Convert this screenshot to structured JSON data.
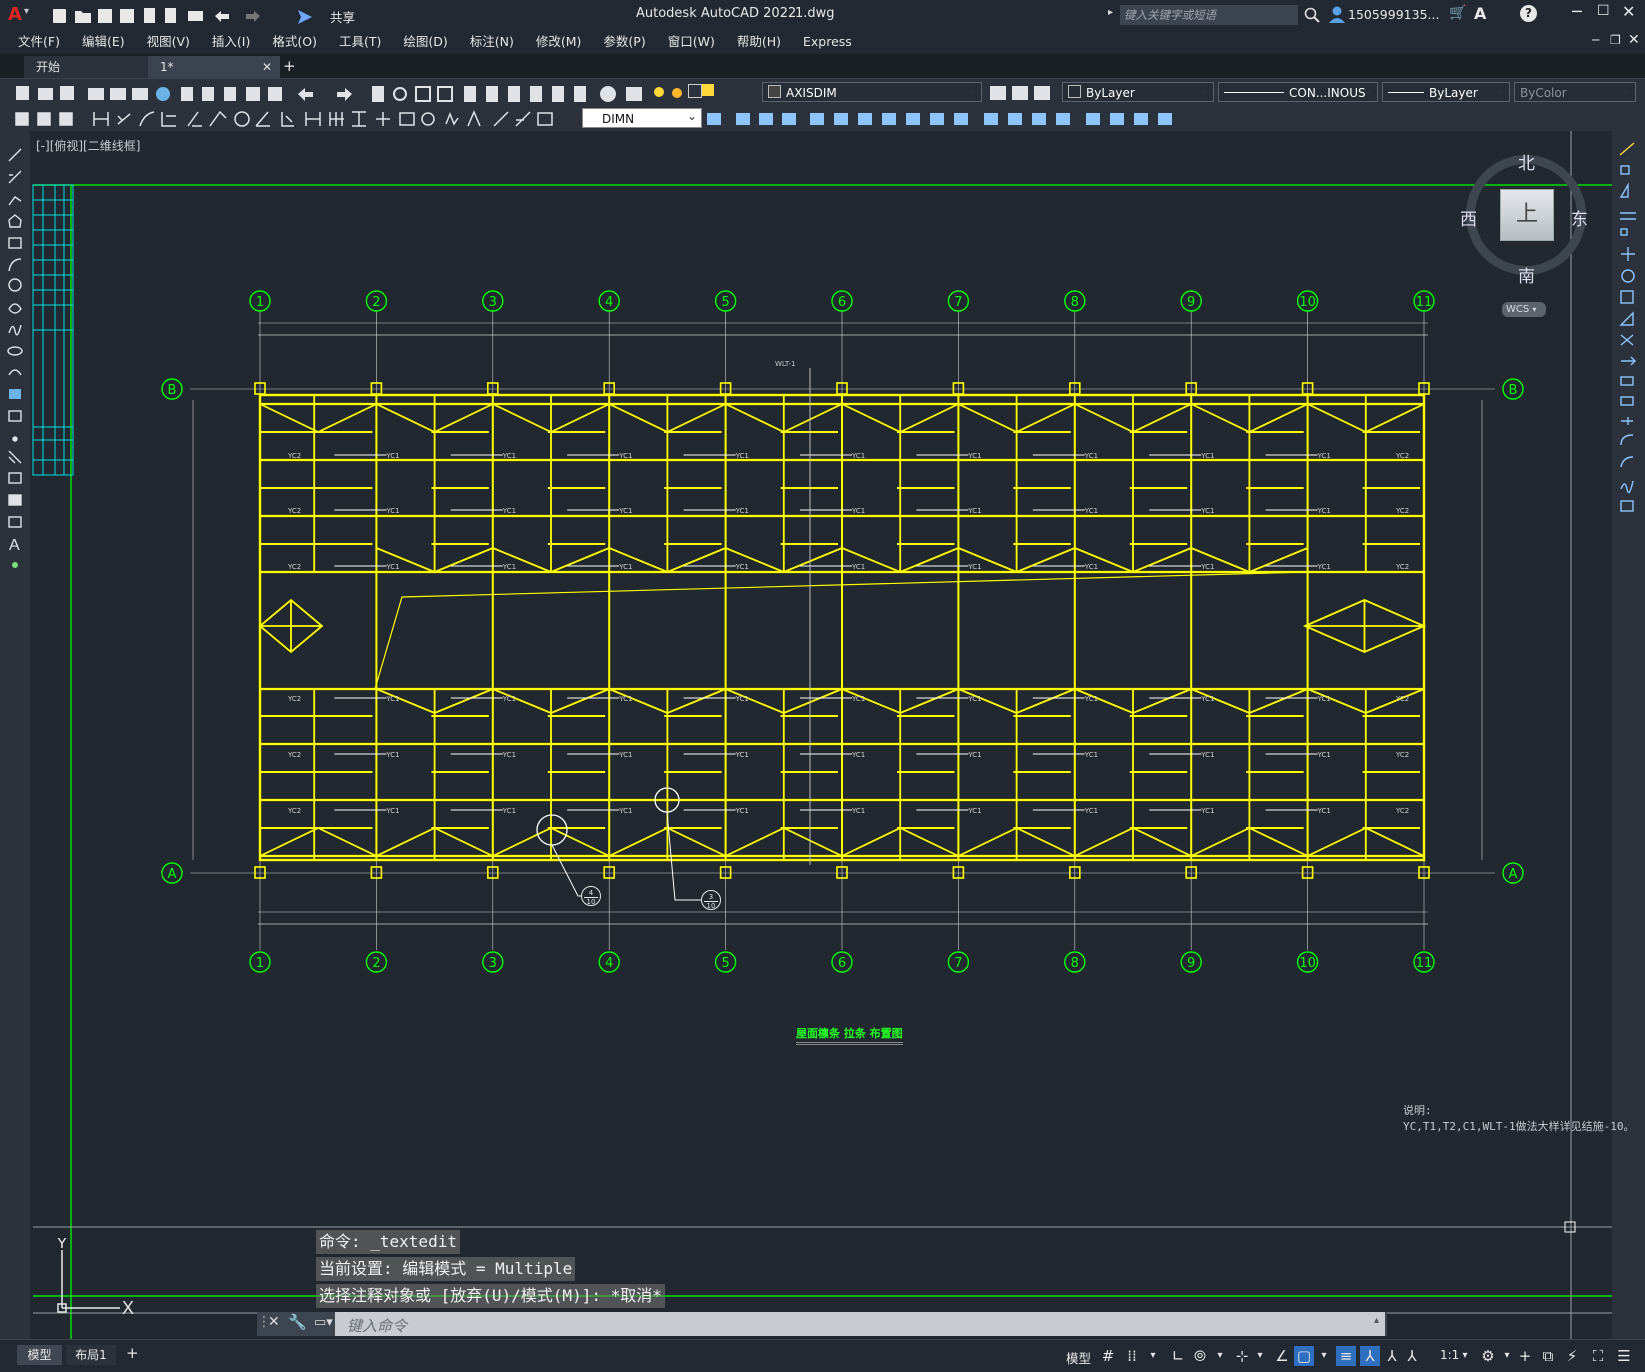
{
  "app": {
    "title": "Autodesk AutoCAD 2022",
    "file": "1.dwg",
    "share_label": "共享",
    "search_placeholder": "键入关键字或短语",
    "user": "1505999135..."
  },
  "menu": [
    "文件(F)",
    "编辑(E)",
    "视图(V)",
    "插入(I)",
    "格式(O)",
    "工具(T)",
    "绘图(D)",
    "标注(N)",
    "修改(M)",
    "参数(P)",
    "窗口(W)",
    "帮助(H)",
    "Express"
  ],
  "tabs": [
    {
      "label": "开始"
    },
    {
      "label": "1*"
    }
  ],
  "toolbar": {
    "dimstyle": "AXISDIM",
    "layer_color": "ByLayer",
    "linetype": "CON...INOUS",
    "lineweight": "ByLayer",
    "plotstyle": "ByColor",
    "layer": "DIMN"
  },
  "viewport": {
    "label": "[-][俯视][二维线框]",
    "viewcube": {
      "north": "北",
      "south": "南",
      "east": "东",
      "west": "西",
      "top": "上",
      "wcs": "WCS"
    }
  },
  "drawing": {
    "axes_top": [
      "1",
      "2",
      "3",
      "4",
      "5",
      "6",
      "7",
      "8",
      "9",
      "10",
      "11"
    ],
    "axes_side": [
      "B",
      "A"
    ],
    "title": "屋面檩条 拉条 布置图",
    "note_title": "说明:",
    "note_body": "YC,T1,T2,C1,WLT-1做法大样详见结施-10。",
    "callouts": [
      {
        "top": "4",
        "bottom": "10"
      },
      {
        "top": "3",
        "bottom": "10"
      }
    ],
    "label_wlt": "WLT-1",
    "purlin_labels": [
      "YC1",
      "YC2"
    ],
    "colors": {
      "grid": "#00ff00",
      "structure": "#ffff00",
      "dim": "#d0d0d0",
      "background": "#212830"
    }
  },
  "commands": {
    "history": [
      "命令: _textedit",
      "当前设置: 编辑模式 = Multiple",
      "选择注释对象或 [放弃(U)/模式(M)]: *取消*"
    ],
    "placeholder": "键入命令"
  },
  "layout_tabs": [
    "模型",
    "布局1"
  ],
  "status": {
    "model": "模型",
    "scale": "1:1"
  },
  "ucs": {
    "x": "X",
    "y": "Y"
  }
}
